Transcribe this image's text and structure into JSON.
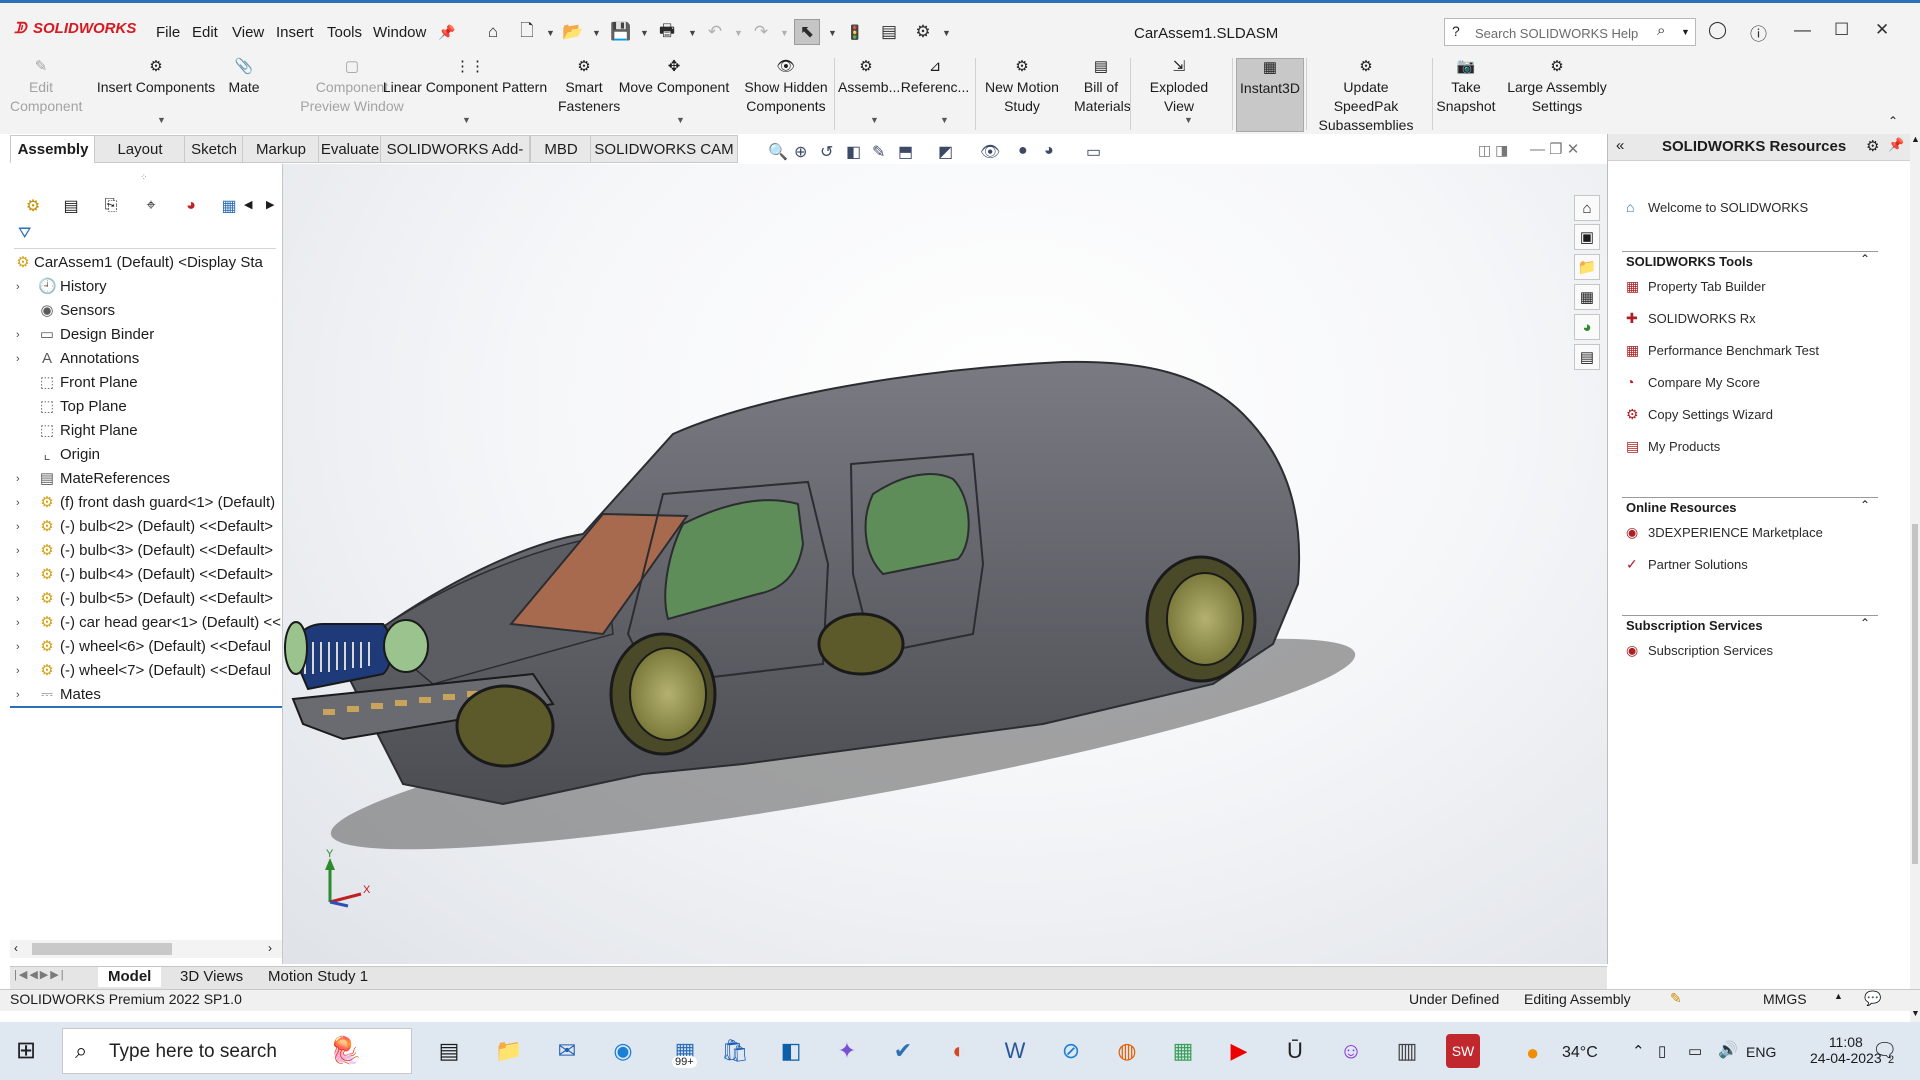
{
  "app": {
    "brand": "SOLIDWORKS",
    "menu": [
      "File",
      "Edit",
      "View",
      "Insert",
      "Tools",
      "Window"
    ],
    "document_title": "CarAssem1.SLDASM",
    "search_placeholder": "Search SOLIDWORKS Help"
  },
  "commands": [
    {
      "label": "Edit\nComponent",
      "icon": "edit-component-icon",
      "enabled": false
    },
    {
      "label": "Insert Components",
      "icon": "insert-components-icon",
      "enabled": true
    },
    {
      "label": "Mate",
      "icon": "mate-icon",
      "enabled": true
    },
    {
      "label": "Component\nPreview Window",
      "icon": "preview-window-icon",
      "enabled": false
    },
    {
      "label": "Linear Component Pattern",
      "icon": "linear-pattern-icon",
      "enabled": true
    },
    {
      "label": "Smart\nFasteners",
      "icon": "smart-fasteners-icon",
      "enabled": true
    },
    {
      "label": "Move Component",
      "icon": "move-component-icon",
      "enabled": true
    },
    {
      "label": "Show Hidden\nComponents",
      "icon": "show-hidden-icon",
      "enabled": true
    },
    {
      "label": "Assemb...",
      "icon": "assembly-features-icon",
      "enabled": true
    },
    {
      "label": "Referenc...",
      "icon": "reference-geometry-icon",
      "enabled": true
    },
    {
      "label": "New Motion\nStudy",
      "icon": "motion-study-icon",
      "enabled": true
    },
    {
      "label": "Bill of\nMaterials",
      "icon": "bom-icon",
      "enabled": true
    },
    {
      "label": "Exploded View",
      "icon": "exploded-view-icon",
      "enabled": true
    },
    {
      "label": "Instant3D",
      "icon": "instant3d-icon",
      "enabled": true,
      "active": true
    },
    {
      "label": "Update SpeedPak\nSubassemblies",
      "icon": "speedpak-icon",
      "enabled": true
    },
    {
      "label": "Take\nSnapshot",
      "icon": "snapshot-icon",
      "enabled": true
    },
    {
      "label": "Large Assembly\nSettings",
      "icon": "large-assembly-icon",
      "enabled": true
    }
  ],
  "tabs": [
    "Assembly",
    "Layout",
    "Sketch",
    "Markup",
    "Evaluate",
    "SOLIDWORKS Add-Ins",
    "MBD",
    "SOLIDWORKS CAM"
  ],
  "active_tab": "Assembly",
  "tree": {
    "root": "CarAssem1 (Default) <Display Sta",
    "items": [
      {
        "label": "History",
        "icon": "history-icon",
        "expandable": true
      },
      {
        "label": "Sensors",
        "icon": "sensors-icon",
        "expandable": false
      },
      {
        "label": "Design Binder",
        "icon": "design-binder-icon",
        "expandable": true
      },
      {
        "label": "Annotations",
        "icon": "annotations-icon",
        "expandable": true
      },
      {
        "label": "Front Plane",
        "icon": "plane-icon",
        "expandable": false
      },
      {
        "label": "Top Plane",
        "icon": "plane-icon",
        "expandable": false
      },
      {
        "label": "Right Plane",
        "icon": "plane-icon",
        "expandable": false
      },
      {
        "label": "Origin",
        "icon": "origin-icon",
        "expandable": false
      },
      {
        "label": "MateReferences",
        "icon": "mate-references-icon",
        "expandable": true
      },
      {
        "label": "(f) front dash guard<1> (Default)",
        "icon": "part-icon",
        "expandable": true
      },
      {
        "label": "(-) bulb<2> (Default) <<Default>",
        "icon": "part-icon",
        "expandable": true
      },
      {
        "label": "(-) bulb<3> (Default) <<Default>",
        "icon": "part-icon",
        "expandable": true
      },
      {
        "label": "(-) bulb<4> (Default) <<Default>",
        "icon": "part-icon",
        "expandable": true
      },
      {
        "label": "(-) bulb<5> (Default) <<Default>",
        "icon": "part-icon",
        "expandable": true
      },
      {
        "label": "(-) car head gear<1> (Default) <<",
        "icon": "part-icon",
        "expandable": true
      },
      {
        "label": "(-) wheel<6> (Default) <<Defaul",
        "icon": "part-icon",
        "expandable": true
      },
      {
        "label": "(-) wheel<7> (Default) <<Defaul",
        "icon": "part-icon",
        "expandable": true
      },
      {
        "label": "Mates",
        "icon": "mates-icon",
        "expandable": true
      }
    ]
  },
  "taskpane": {
    "title": "SOLIDWORKS Resources",
    "welcome": "Welcome to SOLIDWORKS",
    "sections": [
      {
        "title": "SOLIDWORKS Tools",
        "links": [
          "Property Tab Builder",
          "SOLIDWORKS Rx",
          "Performance Benchmark Test",
          "Compare My Score",
          "Copy Settings Wizard",
          "My Products"
        ]
      },
      {
        "title": "Online Resources",
        "links": [
          "3DEXPERIENCE Marketplace",
          "Partner Solutions"
        ]
      },
      {
        "title": "Subscription Services",
        "links": [
          "Subscription Services"
        ]
      }
    ]
  },
  "model_tabs": [
    "Model",
    "3D Views",
    "Motion Study 1"
  ],
  "active_model_tab": "Model",
  "triad": {
    "x": "X",
    "y": "Y"
  },
  "status": {
    "version": "SOLIDWORKS Premium 2022 SP1.0",
    "definition": "Under Defined",
    "mode": "Editing Assembly",
    "units": "MMGS"
  },
  "taskbar": {
    "search_placeholder": "Type here to search",
    "badge": "99+",
    "temperature": "34°C",
    "language": "ENG",
    "time": "11:08",
    "date": "24-04-2023",
    "notifications": "2"
  },
  "colors": {
    "accent": "#2d6fb8",
    "brand": "#d71920",
    "part_icon": "#d4a017",
    "body": "#5f6067",
    "glass": "#5e8d5a",
    "windshield": "#a86a4e"
  }
}
